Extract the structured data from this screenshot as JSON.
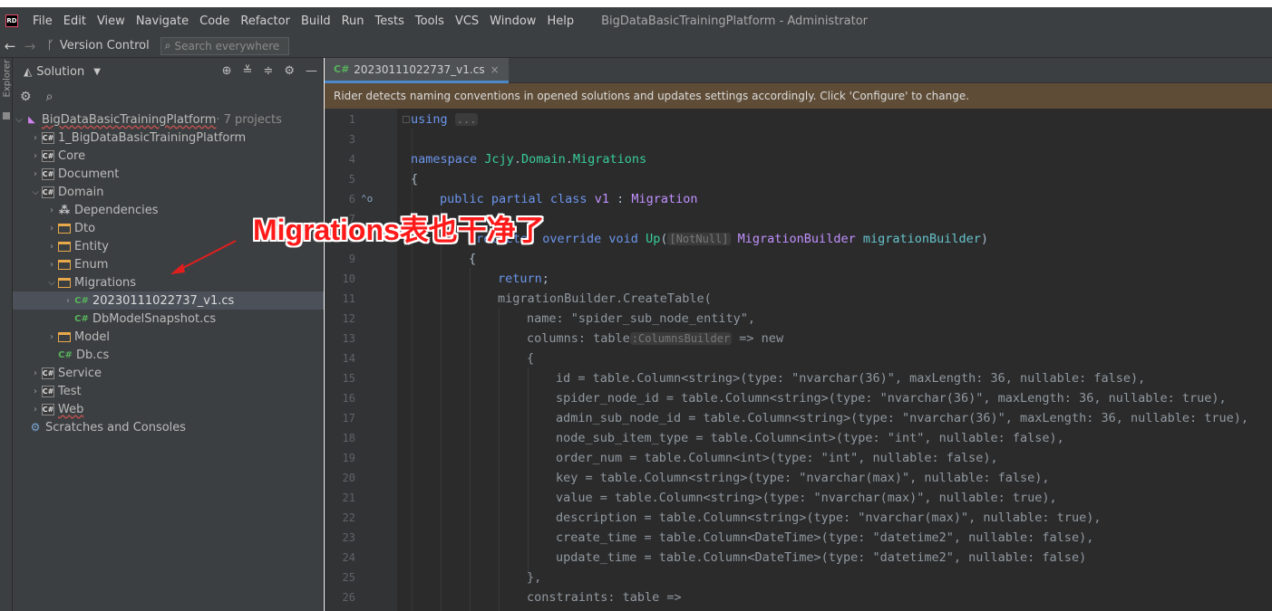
{
  "app": {
    "logo_text": "RD",
    "window_title": "BigDataBasicTrainingPlatform - Administrator"
  },
  "menu": [
    "File",
    "Edit",
    "View",
    "Navigate",
    "Code",
    "Refactor",
    "Build",
    "Run",
    "Tests",
    "Tools",
    "VCS",
    "Window",
    "Help"
  ],
  "navbar": {
    "back_icon": "arrow-left-icon",
    "forward_icon": "arrow-right-icon",
    "vcs_label": "Version Control",
    "search_placeholder": "Search everywhere"
  },
  "leftstrip": {
    "label": "Explorer"
  },
  "sidebar": {
    "title": "Solution",
    "tree": [
      {
        "label": "BigDataBasicTrainingPlatform",
        "suffix": " · 7 projects"
      },
      {
        "label": "1_BigDataBasicTrainingPlatform"
      },
      {
        "label": "Core"
      },
      {
        "label": "Document"
      },
      {
        "label": "Domain"
      },
      {
        "label": "Dependencies"
      },
      {
        "label": "Dto"
      },
      {
        "label": "Entity"
      },
      {
        "label": "Enum"
      },
      {
        "label": "Migrations"
      },
      {
        "label": "20230111022737_v1.cs"
      },
      {
        "label": "DbModelSnapshot.cs"
      },
      {
        "label": "Model"
      },
      {
        "label": "Db.cs"
      },
      {
        "label": "Service"
      },
      {
        "label": "Test"
      },
      {
        "label": "Web"
      },
      {
        "label": "Scratches and Consoles"
      }
    ]
  },
  "editor": {
    "tab": {
      "prefix": "C#",
      "label": "20230111022737_v1.cs",
      "close": "×"
    },
    "banner": "Rider detects naming conventions in opened solutions and updates settings accordingly. Click 'Configure' to change.",
    "line_numbers": [
      "1",
      "3",
      "4",
      "5",
      "6",
      "7",
      "8",
      "9",
      "10",
      "11",
      "12",
      "13",
      "14",
      "15",
      "16",
      "17",
      "18",
      "19",
      "20",
      "21",
      "22",
      "23",
      "24",
      "25",
      "26"
    ]
  },
  "annotation": {
    "text": "Migrations表也干净了",
    "color": "#ff1a1a"
  },
  "colors": {
    "accent": "#4a88c7",
    "banner_bg": "#5e4c36",
    "editor_bg": "#2b2b2b",
    "sidebar_bg": "#3c3f41"
  }
}
